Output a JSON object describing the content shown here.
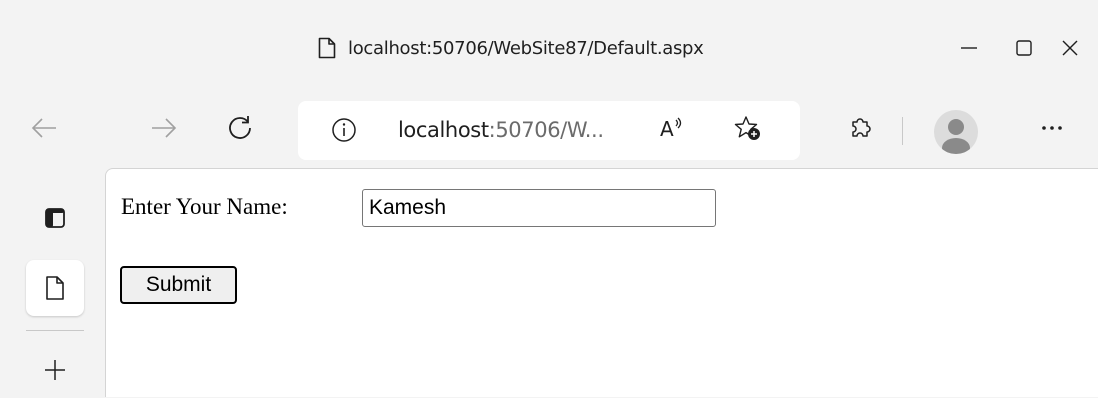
{
  "window": {
    "title": "localhost:50706/WebSite87/Default.aspx",
    "controls": [
      "minimize",
      "maximize",
      "close"
    ]
  },
  "toolbar": {
    "back_icon": "back-arrow-icon",
    "forward_icon": "forward-arrow-icon",
    "refresh_icon": "refresh-icon",
    "address": {
      "host": "localhost",
      "rest": ":50706/W..."
    },
    "read_aloud_icon": "read-aloud-icon",
    "add_favorite_icon": "add-favorite-icon",
    "extensions_icon": "extensions-icon",
    "profile_icon": "profile-avatar",
    "more_icon": "more-options-icon"
  },
  "sidebar": {
    "items": [
      {
        "name": "tab-actions-icon"
      },
      {
        "name": "page-tab-icon",
        "active": true
      },
      {
        "name": "new-tab-icon"
      }
    ]
  },
  "page": {
    "name_label": "Enter Your Name:",
    "name_value": "Kamesh",
    "submit_label": "Submit"
  },
  "colors": {
    "chrome_bg": "#f3f3f3",
    "content_bg": "#ffffff",
    "icon": "#1f1f1f"
  }
}
